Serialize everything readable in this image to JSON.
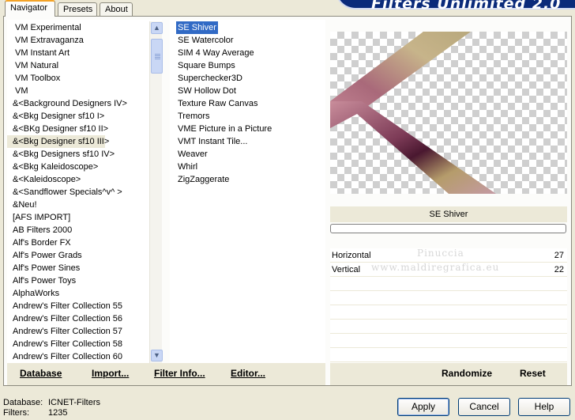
{
  "app_title": "Filters Unlimited 2.0",
  "tabs": [
    {
      "label": "Navigator",
      "active": true
    },
    {
      "label": "Presets",
      "active": false
    },
    {
      "label": "About",
      "active": false
    }
  ],
  "categories": {
    "selected": "&<Bkg Designer sf10 III>",
    "items": [
      "VM Experimental",
      "VM Extravaganza",
      "VM Instant Art",
      "VM Natural",
      "VM Toolbox",
      "VM",
      "&<Background Designers IV>",
      "&<Bkg Designer sf10 I>",
      "&<BKg Designer sf10 II>",
      "&<Bkg Designer sf10 III>",
      "&<Bkg Designers sf10 IV>",
      "&<Bkg Kaleidoscope>",
      "&<Kaleidoscope>",
      "&<Sandflower Specials^v^ >",
      "&Neu!",
      "[AFS IMPORT]",
      "AB Filters 2000",
      "Alf's Border FX",
      "Alf's Power Grads",
      "Alf's Power Sines",
      "Alf's Power Toys",
      "AlphaWorks",
      "Andrew's Filter Collection 55",
      "Andrew's Filter Collection 56",
      "Andrew's Filter Collection 57",
      "Andrew's Filter Collection 58",
      "Andrew's Filter Collection 60"
    ]
  },
  "filters": {
    "selected": "SE Shiver",
    "items": [
      "SE Shiver",
      "SE Watercolor",
      "SIM 4 Way Average",
      "Square Bumps",
      "Superchecker3D",
      "SW Hollow Dot",
      "Texture Raw Canvas",
      "Tremors",
      "VME Picture in a Picture",
      "VMT Instant Tile...",
      "Weaver",
      "Whirl",
      "ZigZaggerate"
    ]
  },
  "preview": {
    "filter_name": "SE Shiver",
    "colors": {
      "gold": "#b7a77a",
      "rose": "#b47b86",
      "plum": "#5a1f3a"
    }
  },
  "parameters": [
    {
      "name": "Horizontal",
      "value": "27"
    },
    {
      "name": "Vertical",
      "value": "22"
    }
  ],
  "watermark": {
    "line1": "Pinuccia",
    "line2": "www.maldiregrafica.eu"
  },
  "left_toolbar": {
    "database": "Database",
    "import": "Import...",
    "filter_info": "Filter Info...",
    "editor": "Editor..."
  },
  "right_toolbar": {
    "randomize": "Randomize",
    "reset": "Reset"
  },
  "status": {
    "database_label": "Database:",
    "database_value": "ICNET-Filters",
    "filters_label": "Filters:",
    "filters_value": "1235"
  },
  "buttons": {
    "apply": "Apply",
    "cancel": "Cancel",
    "help": "Help"
  }
}
